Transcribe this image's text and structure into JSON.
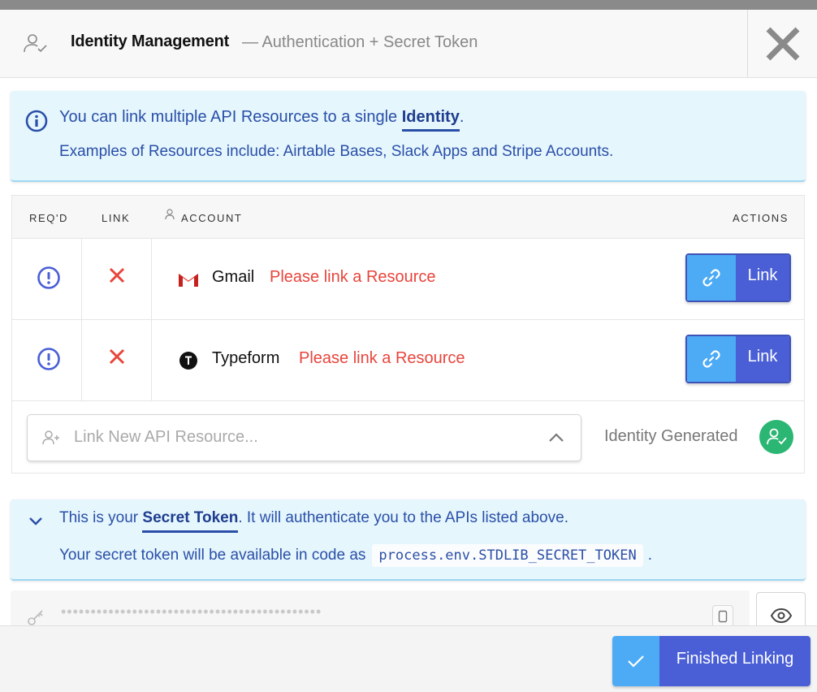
{
  "header": {
    "title": "Identity Management",
    "subtitle": "— Authentication + Secret Token",
    "close_label": "Close"
  },
  "info": {
    "line1_before": "You can link multiple API Resources to a single ",
    "line1_strong": "Identity",
    "line1_after": ".",
    "line2": "Examples of Resources include: Airtable Bases, Slack Apps and Stripe Accounts."
  },
  "table": {
    "columns": {
      "required": "REQ'D",
      "link": "LINK",
      "account": "ACCOUNT",
      "actions": "ACTIONS"
    },
    "rows": [
      {
        "name": "Gmail",
        "status": "Please link a Resource",
        "action": "Link",
        "icon": "gmail-logo"
      },
      {
        "name": "Typeform",
        "status": "Please link a Resource",
        "action": "Link",
        "icon": "typeform-logo"
      }
    ],
    "add_placeholder": "Link New API Resource...",
    "identity_status": "Identity Generated"
  },
  "secret": {
    "line1_before": "This is your ",
    "line1_strong": "Secret Token",
    "line1_after": ". It will authenticate you to the APIs listed above.",
    "line2_before": "Your secret token will be available in code as",
    "code": "process.env.STDLIB_SECRET_TOKEN",
    "line2_after": ".",
    "masked_token": "••••••••••••••••••••••••••••••••••••••••••••"
  },
  "footer": {
    "finish_label": "Finished Linking"
  },
  "colors": {
    "accent": "#4a5fd6",
    "accent_light": "#4dabf5",
    "error": "#e8453c",
    "success": "#2bb673",
    "info_bg": "#e5f6fd",
    "info_text": "#2a4fa8"
  }
}
